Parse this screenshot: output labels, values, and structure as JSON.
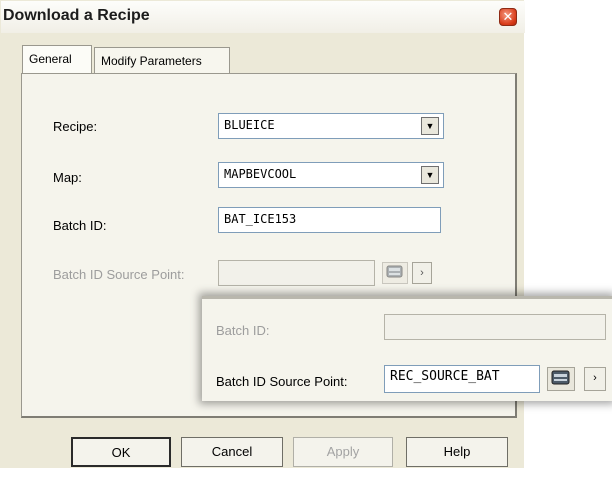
{
  "window": {
    "title": "Download a Recipe",
    "close_glyph": "✕"
  },
  "tabs": [
    {
      "label": "General",
      "selected": true
    },
    {
      "label": "Modify Parameters",
      "selected": false
    }
  ],
  "form": {
    "recipe_label": "Recipe:",
    "recipe_value": "BLUEICE",
    "map_label": "Map:",
    "map_value": "MAPBEVCOOL",
    "batch_id_label": "Batch ID:",
    "batch_id_value": "BAT_ICE153",
    "source_point_label": "Batch ID Source Point:",
    "source_point_value": ""
  },
  "inset": {
    "batch_id_label": "Batch ID:",
    "batch_id_value": "",
    "source_point_label": "Batch ID Source Point:",
    "source_point_value": "REC_SOURCE_BAT"
  },
  "buttons": {
    "ok": "OK",
    "cancel": "Cancel",
    "apply": "Apply",
    "help": "Help"
  },
  "glyphs": {
    "dropdown": "▼",
    "next": "›"
  },
  "icons": {
    "browse": "point-browser-icon"
  }
}
